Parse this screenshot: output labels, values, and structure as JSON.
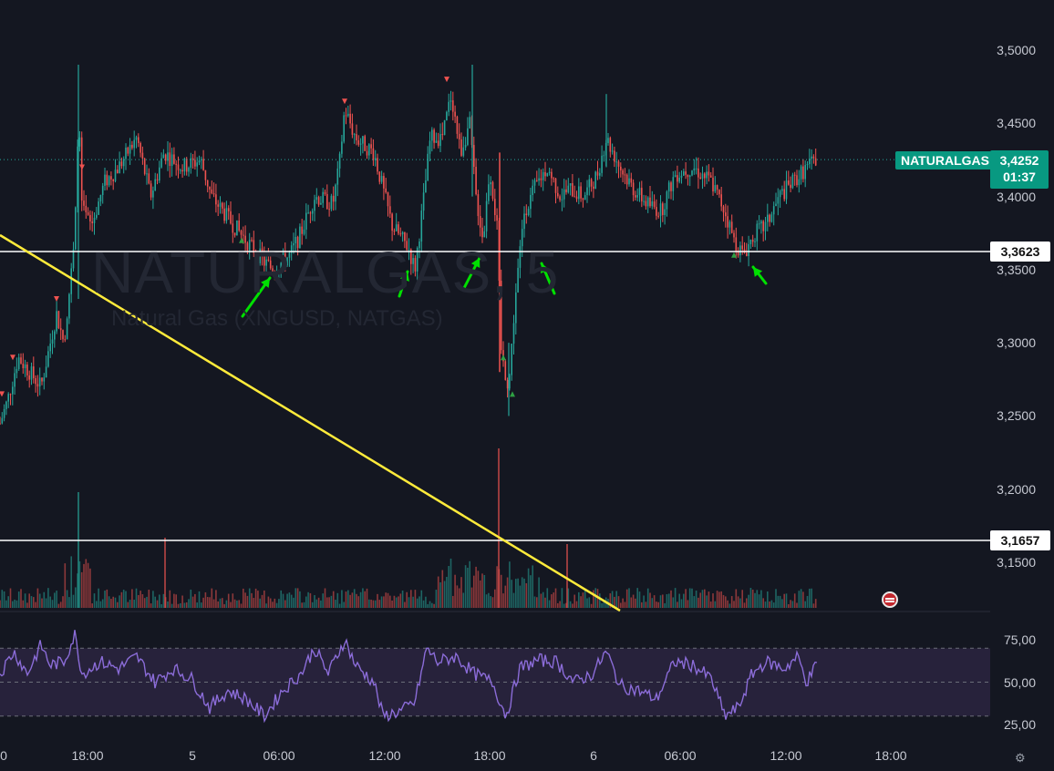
{
  "watermark": {
    "title": "NATURALGAS, 5",
    "subtitle": "Natural Gas (XNGUSD, NATGAS)"
  },
  "price_axis": {
    "ticks": [
      "3,5000",
      "3,4500",
      "3,4000",
      "3,3500",
      "3,3000",
      "3,2500",
      "3,2000",
      "3,1500"
    ]
  },
  "rsi_axis": {
    "ticks": [
      "75,00",
      "50,00",
      "25,00"
    ]
  },
  "time_axis": {
    "ticks": [
      "0",
      "18:00",
      "5",
      "06:00",
      "12:00",
      "18:00",
      "6",
      "06:00",
      "12:00",
      "18:00"
    ]
  },
  "symbol_tag": "NATURALGAS",
  "last_price": {
    "price": "3,4252",
    "countdown": "01:37"
  },
  "horizontal_lines": [
    {
      "label": "3,3623"
    },
    {
      "label": "3,1657"
    }
  ],
  "colors": {
    "background": "#141721",
    "up": "#26a69a",
    "down": "#ef5350",
    "trendline": "#ffeb3b",
    "arrows": "#00e000",
    "rsi_line": "#8b6cd8",
    "rsi_band": "#2a2540",
    "last_price": "#089981"
  },
  "chart_data": [
    {
      "type": "candlestick",
      "title": "NATURALGAS, 5",
      "ylim": [
        3.11,
        3.53
      ],
      "grid": false,
      "close_path": [
        [
          0,
          3.245
        ],
        [
          8,
          3.26
        ],
        [
          20,
          3.29
        ],
        [
          45,
          3.27
        ],
        [
          62,
          3.32
        ],
        [
          70,
          3.3
        ],
        [
          82,
          3.37
        ],
        [
          86,
          3.46
        ],
        [
          90,
          3.39
        ],
        [
          100,
          3.38
        ],
        [
          115,
          3.41
        ],
        [
          130,
          3.42
        ],
        [
          150,
          3.44
        ],
        [
          165,
          3.4
        ],
        [
          180,
          3.43
        ],
        [
          200,
          3.42
        ],
        [
          220,
          3.425
        ],
        [
          232,
          3.4
        ],
        [
          250,
          3.385
        ],
        [
          270,
          3.37
        ],
        [
          290,
          3.355
        ],
        [
          300,
          3.35
        ],
        [
          318,
          3.36
        ],
        [
          330,
          3.375
        ],
        [
          345,
          3.4
        ],
        [
          365,
          3.395
        ],
        [
          372,
          3.42
        ],
        [
          378,
          3.46
        ],
        [
          390,
          3.44
        ],
        [
          410,
          3.43
        ],
        [
          418,
          3.41
        ],
        [
          430,
          3.38
        ],
        [
          448,
          3.365
        ],
        [
          455,
          3.35
        ],
        [
          465,
          3.4
        ],
        [
          472,
          3.44
        ],
        [
          485,
          3.44
        ],
        [
          495,
          3.47
        ],
        [
          505,
          3.43
        ],
        [
          515,
          3.45
        ],
        [
          522,
          3.4
        ],
        [
          530,
          3.37
        ],
        [
          537,
          3.42
        ],
        [
          545,
          3.38
        ],
        [
          550,
          3.29
        ],
        [
          558,
          3.27
        ],
        [
          565,
          3.33
        ],
        [
          575,
          3.39
        ],
        [
          590,
          3.41
        ],
        [
          600,
          3.42
        ],
        [
          615,
          3.4
        ],
        [
          625,
          3.405
        ],
        [
          640,
          3.4
        ],
        [
          655,
          3.415
        ],
        [
          665,
          3.44
        ],
        [
          680,
          3.42
        ],
        [
          695,
          3.405
        ],
        [
          710,
          3.395
        ],
        [
          725,
          3.39
        ],
        [
          740,
          3.415
        ],
        [
          760,
          3.42
        ],
        [
          780,
          3.41
        ],
        [
          795,
          3.39
        ],
        [
          805,
          3.37
        ],
        [
          815,
          3.36
        ],
        [
          828,
          3.375
        ],
        [
          840,
          3.38
        ],
        [
          855,
          3.4
        ],
        [
          870,
          3.41
        ],
        [
          885,
          3.42
        ],
        [
          895,
          3.425
        ]
      ],
      "markers": [
        {
          "x_px_hint": "x",
          "kind": "sell",
          "points": [
            [
              2,
              3.265
            ],
            [
              14,
              3.29
            ],
            [
              62,
              3.33
            ],
            [
              90,
              3.42
            ],
            [
              378,
              3.465
            ],
            [
              490,
              3.48
            ]
          ]
        },
        {
          "kind": "buy",
          "points": [
            [
              265,
              3.37
            ],
            [
              282,
              3.36
            ],
            [
              552,
              3.29
            ],
            [
              562,
              3.265
            ],
            [
              805,
              3.36
            ]
          ]
        }
      ]
    },
    {
      "type": "bar",
      "title": "Volume",
      "series": "volume bars under price pane"
    },
    {
      "type": "line",
      "title": "RSI",
      "ylim": [
        15,
        90
      ],
      "bands": [
        30,
        70
      ],
      "values_path": [
        [
          0,
          55
        ],
        [
          15,
          68
        ],
        [
          30,
          55
        ],
        [
          45,
          72
        ],
        [
          55,
          60
        ],
        [
          70,
          62
        ],
        [
          82,
          78
        ],
        [
          90,
          55
        ],
        [
          110,
          62
        ],
        [
          130,
          58
        ],
        [
          150,
          65
        ],
        [
          170,
          50
        ],
        [
          190,
          58
        ],
        [
          210,
          52
        ],
        [
          230,
          35
        ],
        [
          250,
          45
        ],
        [
          270,
          40
        ],
        [
          290,
          30
        ],
        [
          310,
          45
        ],
        [
          330,
          55
        ],
        [
          345,
          70
        ],
        [
          360,
          55
        ],
        [
          378,
          75
        ],
        [
          390,
          60
        ],
        [
          410,
          50
        ],
        [
          420,
          30
        ],
        [
          440,
          33
        ],
        [
          455,
          38
        ],
        [
          468,
          70
        ],
        [
          480,
          62
        ],
        [
          500,
          65
        ],
        [
          520,
          55
        ],
        [
          540,
          50
        ],
        [
          555,
          30
        ],
        [
          570,
          58
        ],
        [
          590,
          63
        ],
        [
          610,
          62
        ],
        [
          630,
          50
        ],
        [
          650,
          55
        ],
        [
          665,
          68
        ],
        [
          680,
          48
        ],
        [
          700,
          45
        ],
        [
          720,
          40
        ],
        [
          740,
          62
        ],
        [
          760,
          60
        ],
        [
          780,
          52
        ],
        [
          795,
          30
        ],
        [
          810,
          35
        ],
        [
          825,
          55
        ],
        [
          840,
          62
        ],
        [
          860,
          58
        ],
        [
          875,
          65
        ],
        [
          885,
          50
        ],
        [
          895,
          60
        ]
      ]
    }
  ]
}
